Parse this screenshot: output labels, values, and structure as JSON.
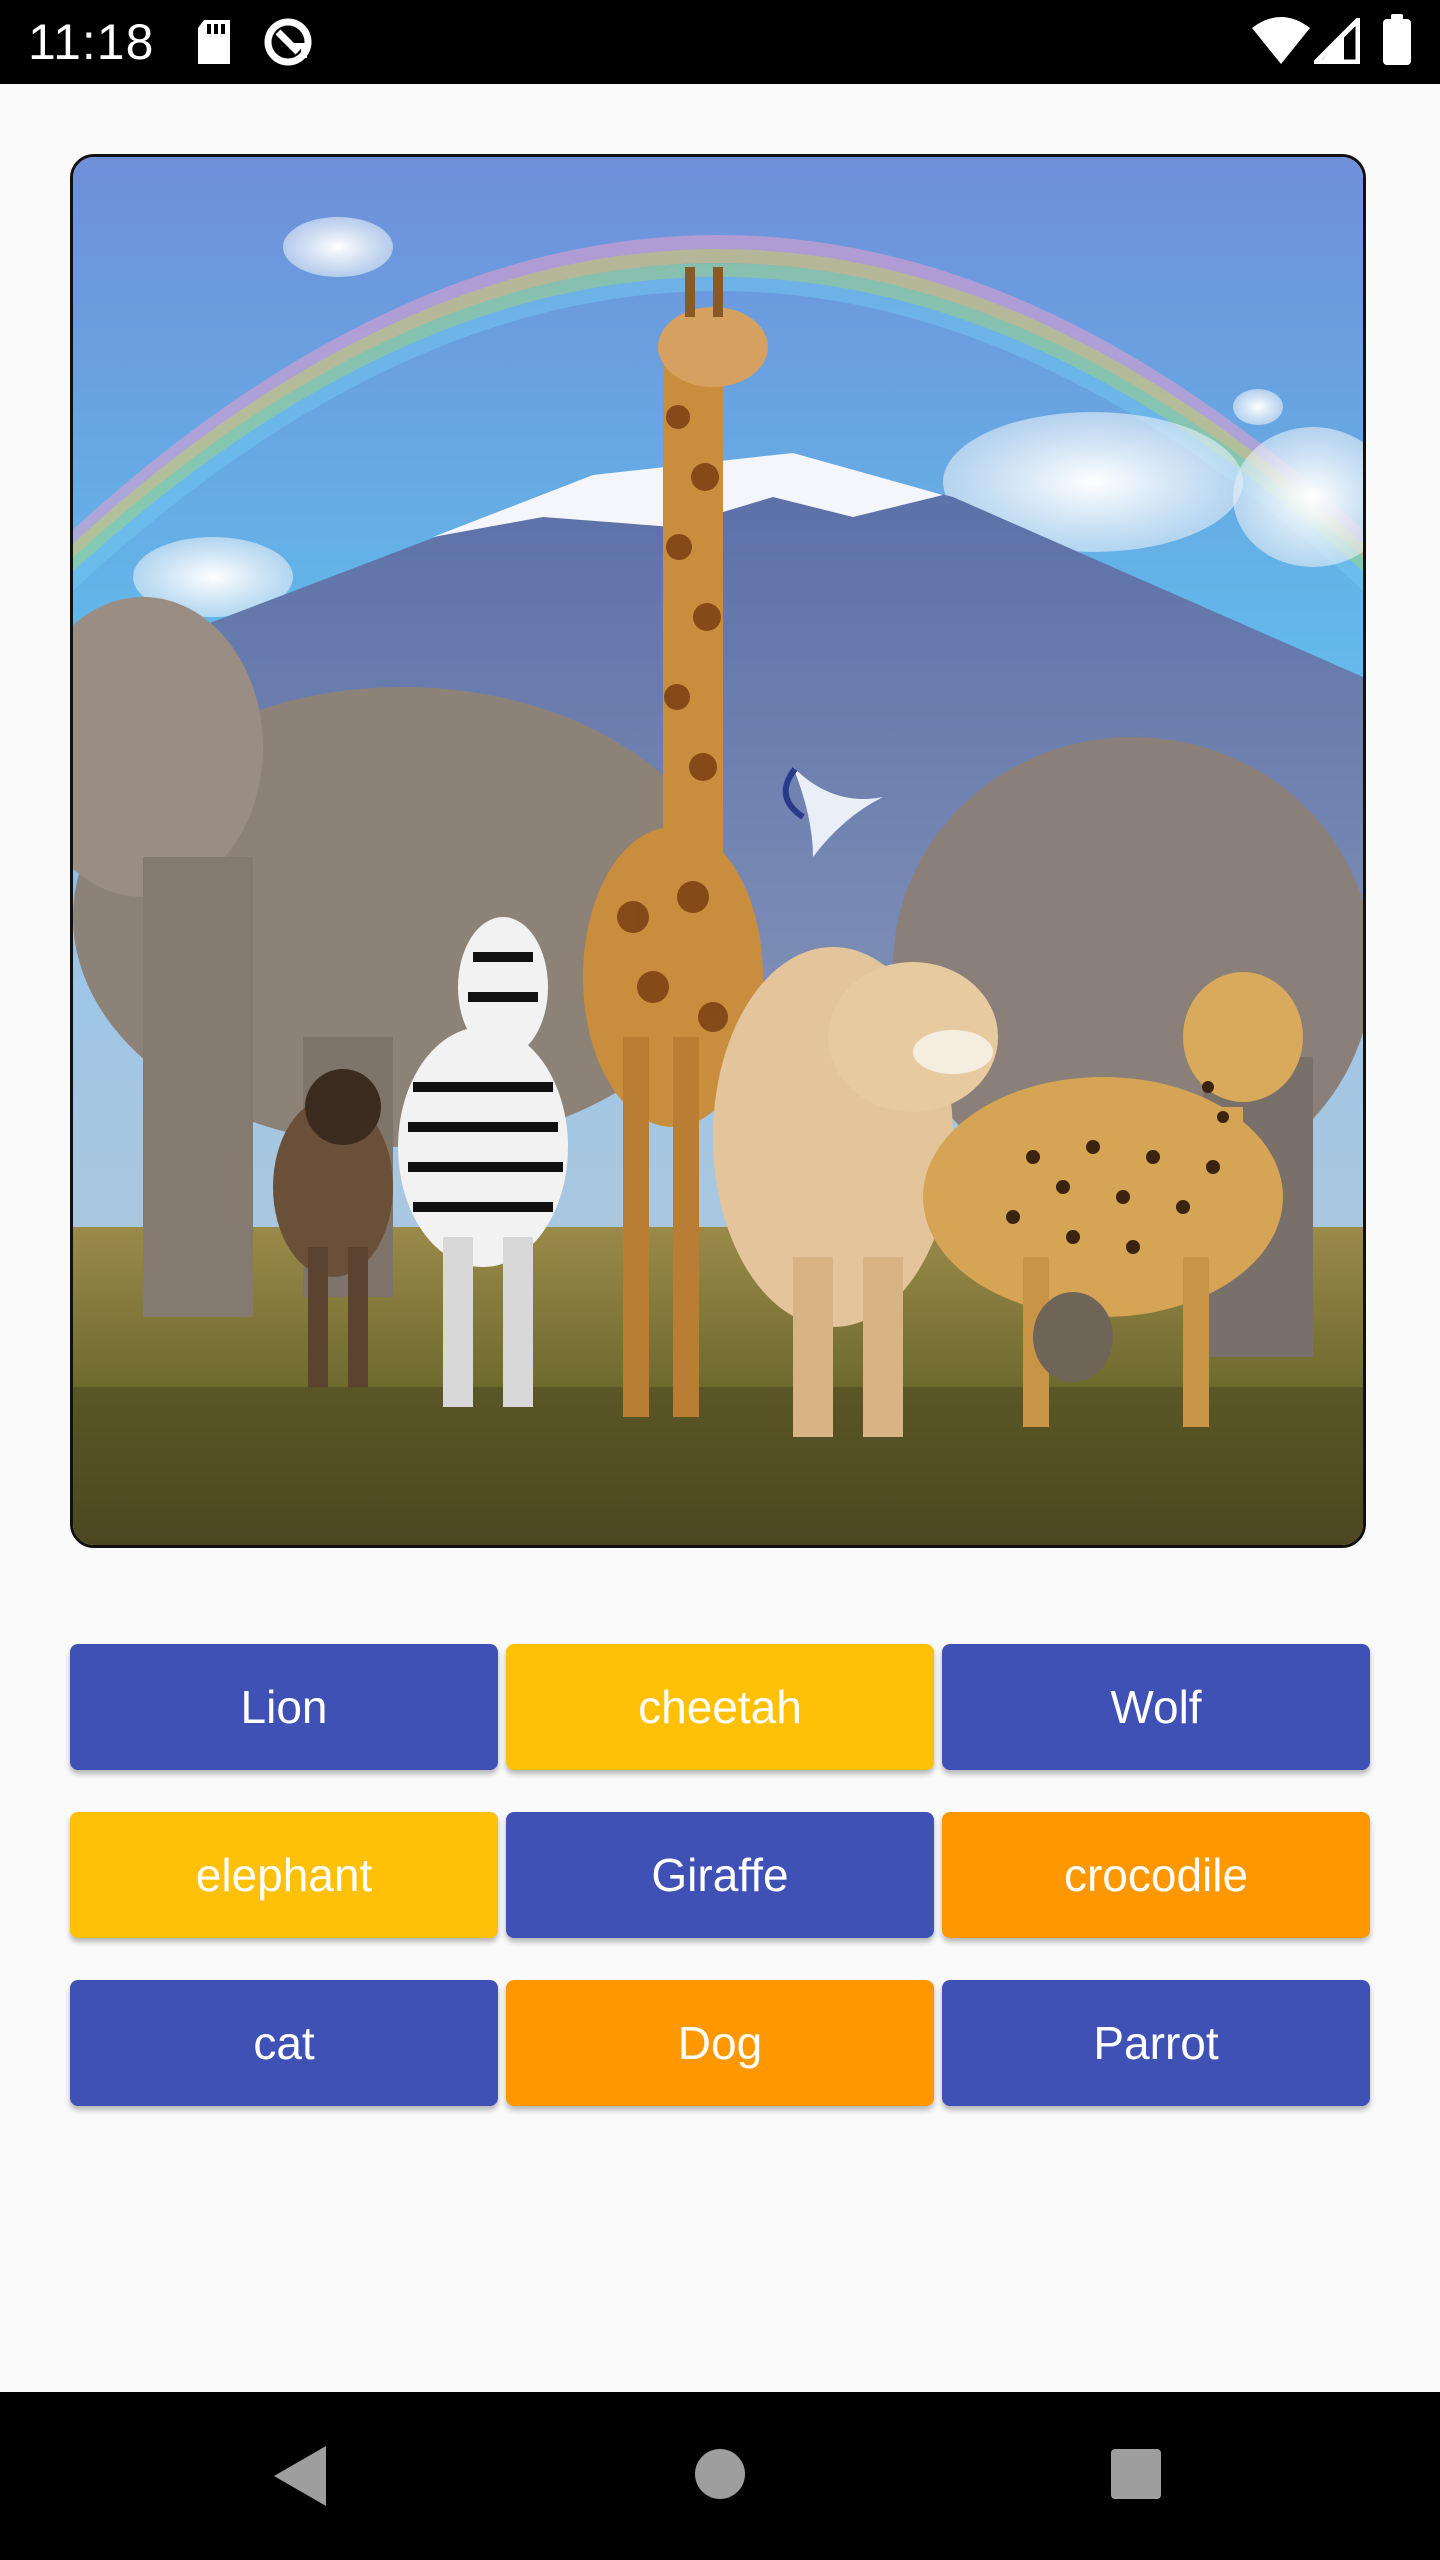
{
  "status_bar": {
    "time": "11:18",
    "left_icons": [
      "sd-card-icon",
      "sync-icon"
    ],
    "right_icons": [
      "wifi-icon",
      "signal-icon",
      "battery-icon"
    ]
  },
  "hero_image": {
    "description_icon": "safari-animals-image"
  },
  "options": [
    {
      "label": "Lion",
      "color": "#3f51b5"
    },
    {
      "label": "cheetah",
      "color": "#ffc107"
    },
    {
      "label": "Wolf",
      "color": "#3f51b5"
    },
    {
      "label": "elephant",
      "color": "#ffc107"
    },
    {
      "label": "Giraffe",
      "color": "#3f51b5"
    },
    {
      "label": "crocodile",
      "color": "#ff9800"
    },
    {
      "label": "cat",
      "color": "#3f51b5"
    },
    {
      "label": "Dog",
      "color": "#ff9800"
    },
    {
      "label": "Parrot",
      "color": "#3f51b5"
    }
  ],
  "navigation": {
    "back_icon": "back-triangle-icon",
    "home_icon": "home-circle-icon",
    "recents_icon": "recents-square-icon"
  }
}
